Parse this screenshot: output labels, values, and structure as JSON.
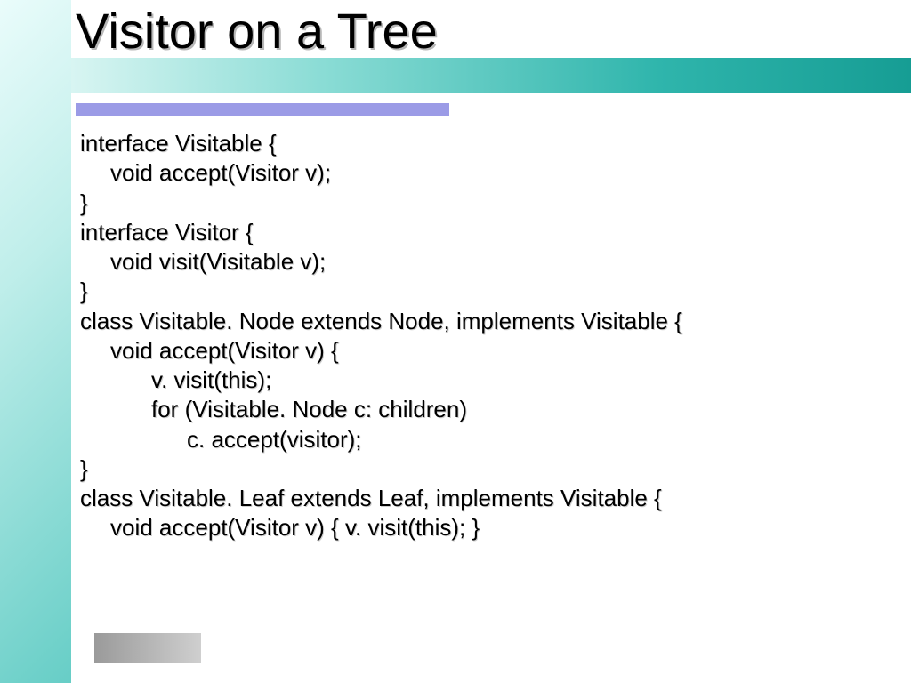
{
  "title": "Visitor on a Tree",
  "code_lines": [
    {
      "indent": 0,
      "text": "interface Visitable {"
    },
    {
      "indent": 1,
      "text": "void accept(Visitor v);"
    },
    {
      "indent": 0,
      "text": "}"
    },
    {
      "indent": 0,
      "text": "interface Visitor {"
    },
    {
      "indent": 1,
      "text": "void visit(Visitable v);"
    },
    {
      "indent": 0,
      "text": "}"
    },
    {
      "indent": 0,
      "text": "class Visitable. Node extends Node, implements Visitable {"
    },
    {
      "indent": 1,
      "text": "void accept(Visitor v) {"
    },
    {
      "indent": 2,
      "text": "v. visit(this);"
    },
    {
      "indent": 2,
      "text": "for (Visitable. Node c: children)"
    },
    {
      "indent": 3,
      "text": "c. accept(visitor);"
    },
    {
      "indent": 0,
      "text": "}"
    },
    {
      "indent": 0,
      "text": "class Visitable. Leaf extends Leaf, implements Visitable {"
    },
    {
      "indent": 1,
      "text": "void accept(Visitor v) { v. visit(this); }"
    }
  ],
  "colors": {
    "accent_bar": "#9b9be6",
    "teal_gradient_end": "#169d94"
  }
}
